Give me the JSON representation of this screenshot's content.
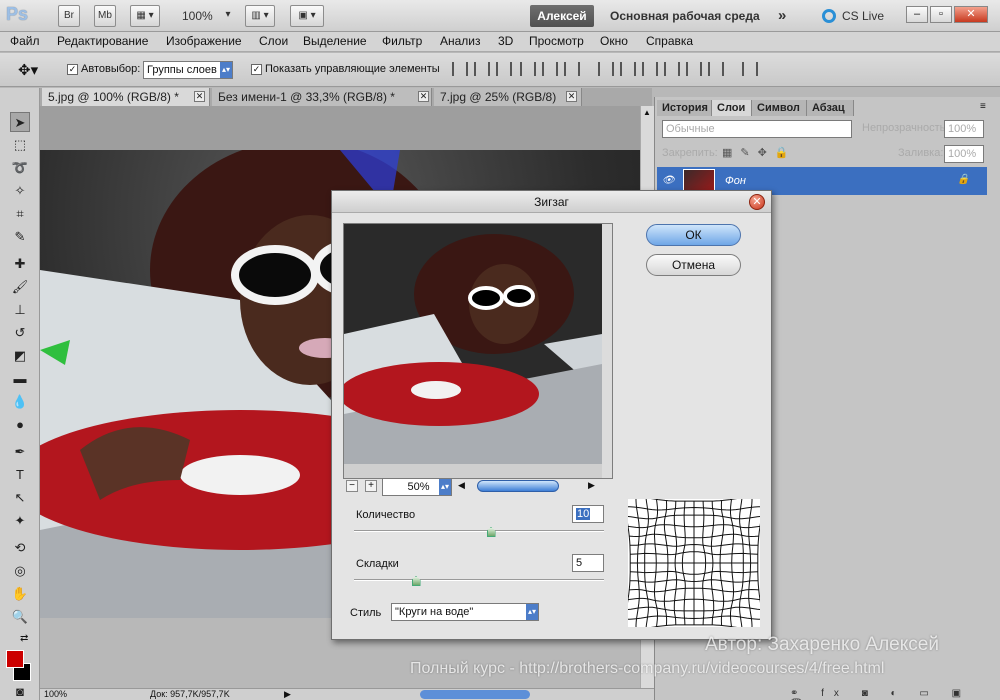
{
  "app": {
    "logo": "Ps",
    "bridge_btn": "Br",
    "minibridge_btn": "Mb",
    "zoom": "100%",
    "user_btn": "Алексей",
    "workspace": "Основная рабочая среда",
    "more": "»",
    "cslive": "CS Live"
  },
  "menu": [
    "Файл",
    "Редактирование",
    "Изображение",
    "Слои",
    "Выделение",
    "Фильтр",
    "Анализ",
    "3D",
    "Просмотр",
    "Окно",
    "Справка"
  ],
  "options": {
    "autoselect_label": "Автовыбор:",
    "autoselect_value": "Группы слоев",
    "show_controls_label": "Показать управляющие элементы"
  },
  "tabs": [
    {
      "label": "5.jpg @ 100% (RGB/8) *"
    },
    {
      "label": "Без имени-1 @ 33,3% (RGB/8) *"
    },
    {
      "label": "7.jpg @ 25% (RGB/8)"
    }
  ],
  "panels": {
    "tabs": [
      "История",
      "Слои",
      "Символ",
      "Абзац"
    ],
    "blend_mode": "Обычные",
    "opacity_label": "Непрозрачность:",
    "opacity_value": "100%",
    "lock_label": "Закрепить:",
    "fill_label": "Заливка:",
    "fill_value": "100%",
    "layer_name": "Фон"
  },
  "status": {
    "zoom": "100%",
    "doc": "Док: 957,7K/957,7K"
  },
  "dialog": {
    "title": "Зигзаг",
    "ok": "ОК",
    "cancel": "Отмена",
    "preview_zoom": "50%",
    "amount_label": "Количество",
    "amount_value": "10",
    "amount_fraction": 0.55,
    "ridges_label": "Складки",
    "ridges_value": "5",
    "ridges_fraction": 0.25,
    "style_label": "Стиль",
    "style_value": "\"Круги на воде\""
  },
  "watermark": {
    "author": "Автор: Захаренко Алексей",
    "course": "Полный курс - http://brothers-company.ru/videocourses/4/free.html"
  },
  "colors": {
    "foreground": "#cc0000",
    "background": "#000000",
    "layer_selected": "#3b6fc0",
    "ok_button": "#6fa6e7"
  }
}
